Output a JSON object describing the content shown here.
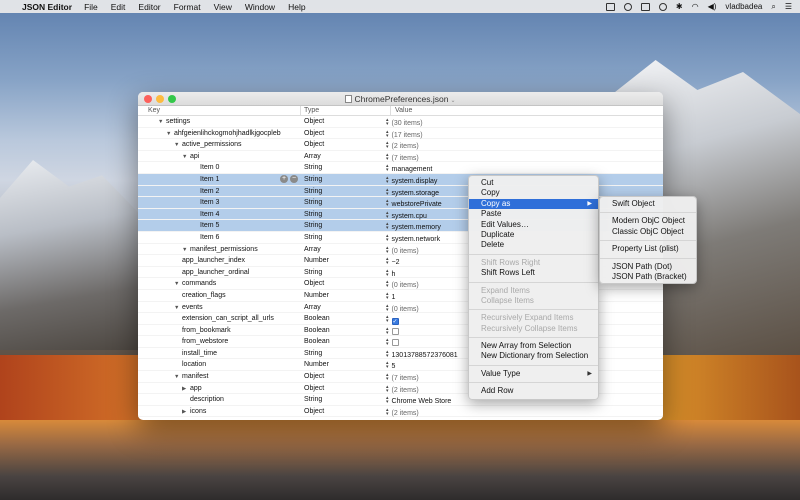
{
  "menubar": {
    "app_name": "JSON Editor",
    "items": [
      "File",
      "Edit",
      "Editor",
      "Format",
      "View",
      "Window",
      "Help"
    ],
    "username": "vladbadea"
  },
  "window": {
    "title": "ChromePreferences.json",
    "columns": {
      "key": "Key",
      "type": "Type",
      "value": "Value"
    }
  },
  "rows": [
    {
      "key": "settings",
      "type": "Object",
      "value": "(30 items)"
    },
    {
      "key": "ahfgeienlihckogmohjhadlkjgocpleb",
      "type": "Object",
      "value": "(17 items)"
    },
    {
      "key": "active_permissions",
      "type": "Object",
      "value": "(2 items)"
    },
    {
      "key": "api",
      "type": "Array",
      "value": "(7 items)"
    },
    {
      "key": "Item 0",
      "type": "String",
      "value": "management"
    },
    {
      "key": "Item 1",
      "type": "String",
      "value": "system.display"
    },
    {
      "key": "Item 2",
      "type": "String",
      "value": "system.storage"
    },
    {
      "key": "Item 3",
      "type": "String",
      "value": "webstorePrivate"
    },
    {
      "key": "Item 4",
      "type": "String",
      "value": "system.cpu"
    },
    {
      "key": "Item 5",
      "type": "String",
      "value": "system.memory"
    },
    {
      "key": "Item 6",
      "type": "String",
      "value": "system.network"
    },
    {
      "key": "manifest_permissions",
      "type": "Array",
      "value": "(0 items)"
    },
    {
      "key": "app_launcher_index",
      "type": "Number",
      "value": "−2"
    },
    {
      "key": "app_launcher_ordinal",
      "type": "String",
      "value": "h"
    },
    {
      "key": "commands",
      "type": "Object",
      "value": "(0 items)"
    },
    {
      "key": "creation_flags",
      "type": "Number",
      "value": "1"
    },
    {
      "key": "events",
      "type": "Array",
      "value": "(0 items)"
    },
    {
      "key": "extension_can_script_all_urls",
      "type": "Boolean",
      "value": ""
    },
    {
      "key": "from_bookmark",
      "type": "Boolean",
      "value": ""
    },
    {
      "key": "from_webstore",
      "type": "Boolean",
      "value": ""
    },
    {
      "key": "install_time",
      "type": "String",
      "value": "13013788572376081"
    },
    {
      "key": "location",
      "type": "Number",
      "value": "5"
    },
    {
      "key": "manifest",
      "type": "Object",
      "value": "(7 items)"
    },
    {
      "key": "app",
      "type": "Object",
      "value": "(2 items)"
    },
    {
      "key": "description",
      "type": "String",
      "value": "Chrome Web Store"
    },
    {
      "key": "icons",
      "type": "Object",
      "value": "(2 items)"
    }
  ],
  "context_menu": {
    "items": [
      "Cut",
      "Copy",
      "Copy as",
      "Paste",
      "Edit Values…",
      "Duplicate",
      "Delete",
      "Shift Rows Right",
      "Shift Rows Left",
      "Expand Items",
      "Collapse Items",
      "Recursively Expand Items",
      "Recursively Collapse Items",
      "New Array from Selection",
      "New Dictionary from Selection",
      "Value Type",
      "Add Row"
    ]
  },
  "submenu": {
    "items": [
      "Swift Object",
      "Modern ObjC Object",
      "Classic ObjC Object",
      "Property List (plist)",
      "JSON Path (Dot)",
      "JSON Path (Bracket)"
    ]
  }
}
